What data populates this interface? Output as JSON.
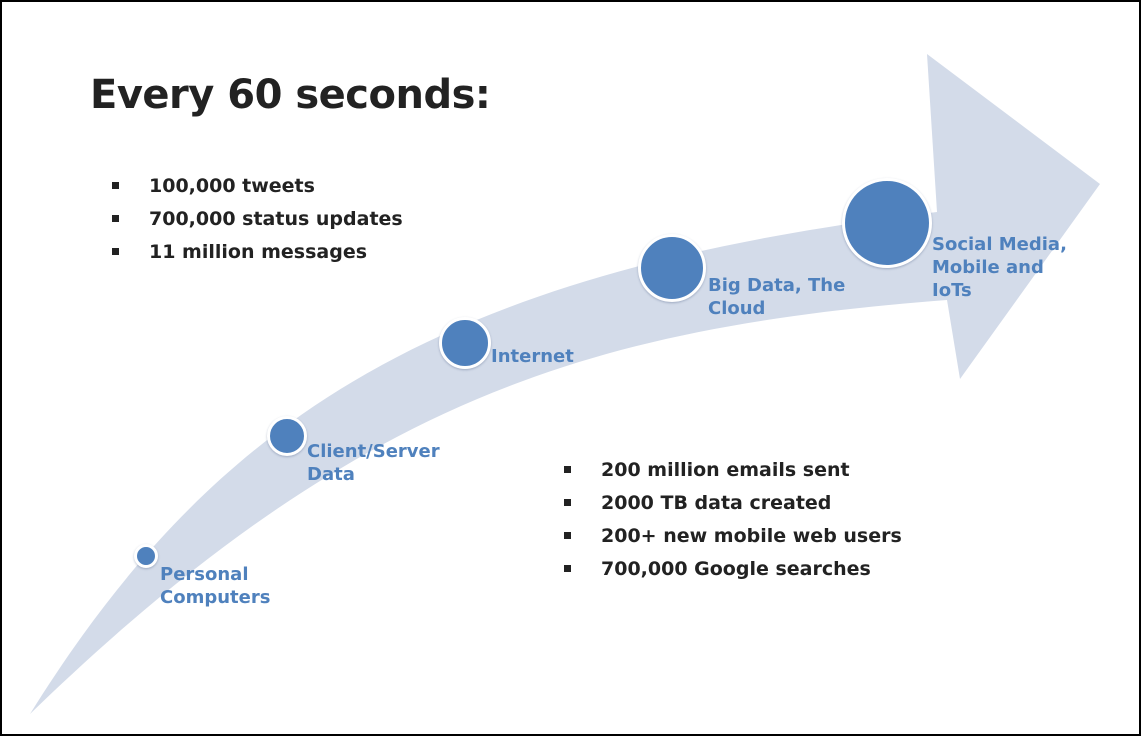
{
  "title": "Every 60 seconds:",
  "stats_top": [
    "100,000 tweets",
    "700,000 status updates",
    "11 million messages"
  ],
  "stats_bottom": [
    "200 million emails sent",
    "2000 TB data created",
    "200+ new mobile web users",
    "700,000 Google searches"
  ],
  "stages": [
    {
      "label": "Personal\nComputers"
    },
    {
      "label": "Client/Server\nData"
    },
    {
      "label": "Internet"
    },
    {
      "label": "Big Data, The\nCloud"
    },
    {
      "label": "Social Media,\nMobile and\nIoTs"
    }
  ],
  "colors": {
    "arrow_fill": "#d3dbe9",
    "node_fill": "#4f81bd",
    "label_text": "#4f81bd",
    "body_text": "#222222",
    "border": "#000000"
  }
}
